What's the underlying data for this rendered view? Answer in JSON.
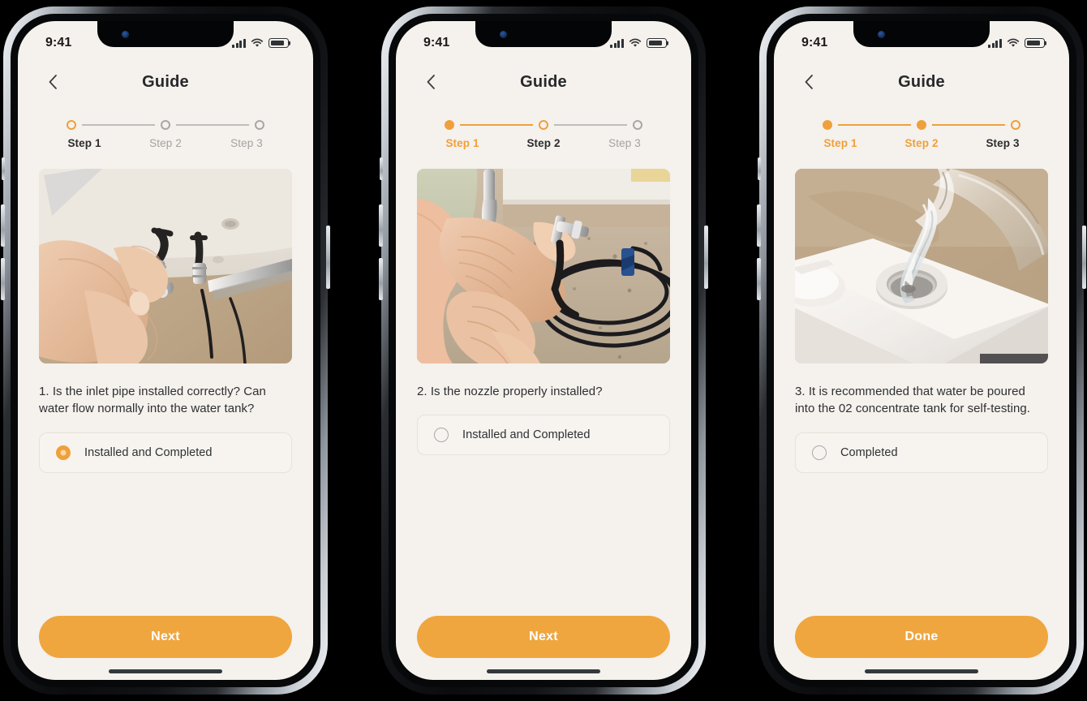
{
  "screens": [
    {
      "status": {
        "time": "9:41",
        "cellular_icon": "cellular-bars-icon",
        "wifi_icon": "wifi-icon",
        "battery_icon": "battery-icon"
      },
      "nav": {
        "back_icon": "chevron-left-icon",
        "title": "Guide"
      },
      "stepper": {
        "steps": [
          {
            "label": "Step 1",
            "state": "current"
          },
          {
            "label": "Step 2",
            "state": "todo"
          },
          {
            "label": "Step 3",
            "state": "todo"
          }
        ],
        "connectors": [
          "grey",
          "grey"
        ]
      },
      "photo": {
        "alt": "Hands installing an inlet pipe fitting under a white cabinet"
      },
      "question": "1. Is the inlet pipe installed correctly? Can water flow normally into the water tank?",
      "answer": {
        "label": "Installed and Completed",
        "selected": true
      },
      "cta": {
        "label": "Next"
      }
    },
    {
      "status": {
        "time": "9:41",
        "cellular_icon": "cellular-bars-icon",
        "wifi_icon": "wifi-icon",
        "battery_icon": "battery-icon"
      },
      "nav": {
        "back_icon": "chevron-left-icon",
        "title": "Guide"
      },
      "stepper": {
        "steps": [
          {
            "label": "Step 1",
            "state": "done"
          },
          {
            "label": "Step 2",
            "state": "current"
          },
          {
            "label": "Step 3",
            "state": "todo"
          }
        ],
        "connectors": [
          "orange",
          "grey"
        ]
      },
      "photo": {
        "alt": "Hands attaching a nozzle to black tubing on a granite countertop"
      },
      "question": "2. Is the nozzle properly installed?",
      "answer": {
        "label": "Installed and Completed",
        "selected": false
      },
      "cta": {
        "label": "Next"
      }
    },
    {
      "status": {
        "time": "9:41",
        "cellular_icon": "cellular-bars-icon",
        "wifi_icon": "wifi-icon",
        "battery_icon": "battery-icon"
      },
      "nav": {
        "back_icon": "chevron-left-icon",
        "title": "Guide"
      },
      "stepper": {
        "steps": [
          {
            "label": "Step 1",
            "state": "done"
          },
          {
            "label": "Step 2",
            "state": "done"
          },
          {
            "label": "Step 3",
            "state": "current"
          }
        ],
        "connectors": [
          "orange",
          "orange"
        ]
      },
      "photo": {
        "alt": "Water poured from a glass pitcher into a round port on a white appliance"
      },
      "question": "3. It is recommended that water be poured into the 02 concentrate tank for self-testing.",
      "answer": {
        "label": "Completed",
        "selected": false
      },
      "cta": {
        "label": "Done"
      }
    }
  ],
  "colors": {
    "accent": "#EFA63F",
    "accent_step": "#EFA03C",
    "screen_bg": "#F5F1EC",
    "card_bg": "#F7F4F0",
    "card_border": "#E6E1DB",
    "text_primary": "#2e3033",
    "text_muted": "#A3A3A3"
  }
}
